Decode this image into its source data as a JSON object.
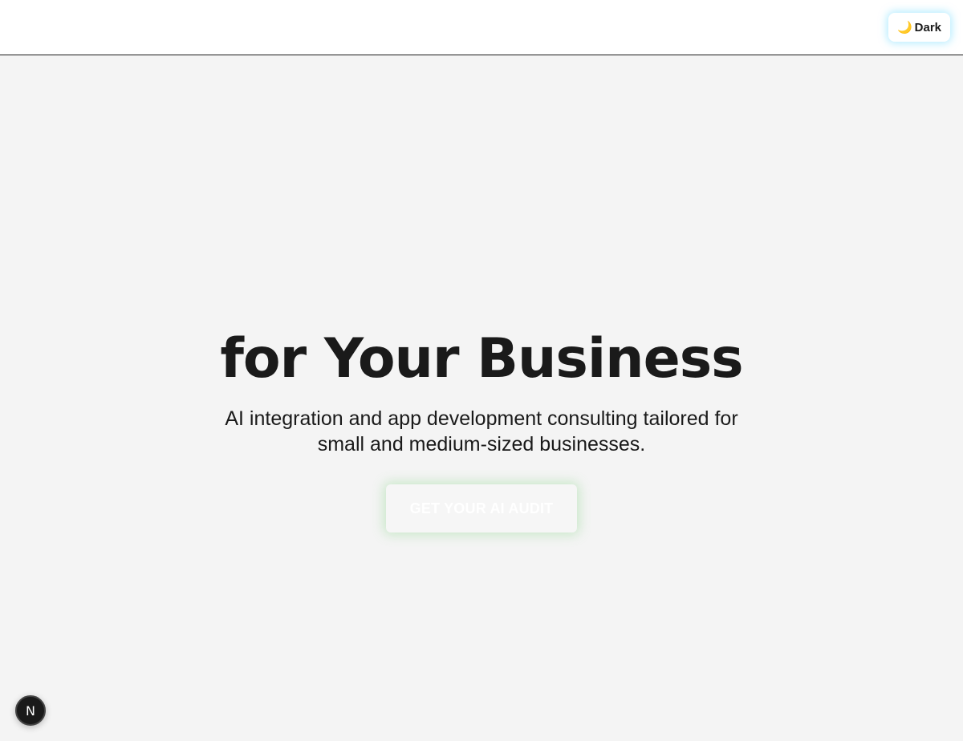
{
  "header": {
    "theme_toggle": {
      "icon": "moon-icon",
      "icon_glyph": "🌙",
      "label": "Dark"
    }
  },
  "hero": {
    "title": "for Your Business",
    "subtitle": "AI integration and app development consulting tailored for small and medium-sized businesses.",
    "cta_label": "GET YOUR AI AUDIT"
  },
  "dev_badge": {
    "icon": "nextjs-icon",
    "glyph": "N"
  },
  "colors": {
    "background": "#f4f4f4",
    "header_background": "#ffffff",
    "text": "#1a1a1a",
    "toggle_glow": "#78dcff",
    "cta_glow": "#78d278",
    "badge_background": "#1a1a1a"
  }
}
